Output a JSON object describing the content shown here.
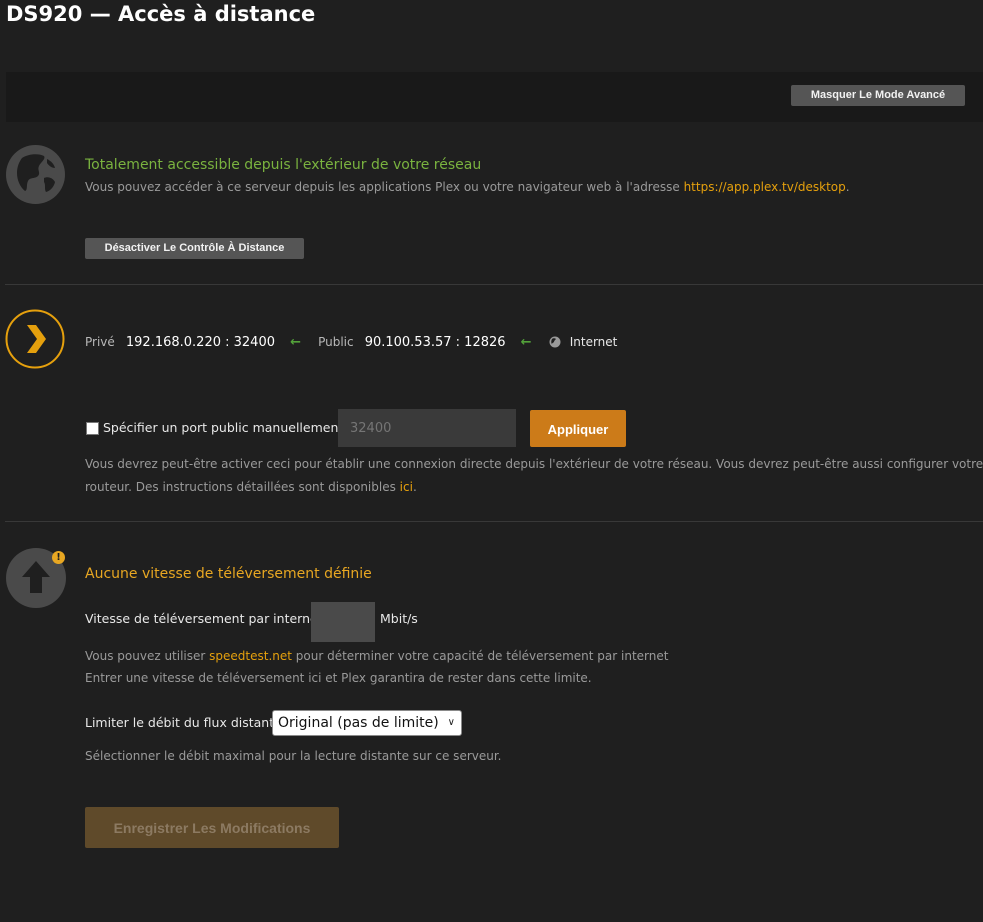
{
  "page": {
    "title": "DS920 — Accès à distance"
  },
  "toolbar": {
    "advanced_button": "Masquer Le Mode Avancé"
  },
  "status": {
    "title": "Totalement accessible depuis l'extérieur de votre réseau",
    "desc_prefix": "Vous pouvez accéder à ce serveur depuis les applications Plex ou votre navigateur web à l'adresse ",
    "desc_link": "https://app.plex.tv/desktop",
    "desc_suffix": ".",
    "disable_button": "Désactiver Le Contrôle À Distance",
    "icon": "globe-icon"
  },
  "connection": {
    "private_label": "Privé",
    "private_value": "192.168.0.220 : 32400",
    "public_label": "Public",
    "public_value": "90.100.53.57 : 12826",
    "internet_label": "Internet",
    "icon": "plex-chevron-icon"
  },
  "manual_port": {
    "checkbox_label": "Spécifier un port public manuellement",
    "checked": false,
    "placeholder": "32400",
    "apply_button": "Appliquer",
    "help_line1": "Vous devrez peut-être activer ceci pour établir une connexion directe depuis l'extérieur de votre réseau. Vous devrez peut-être aussi configurer votre",
    "help_line2_prefix": "routeur. Des instructions détaillées sont disponibles ",
    "help_link": "ici",
    "help_line2_suffix": "."
  },
  "upload": {
    "warning_title": "Aucune vitesse de téléversement définie",
    "speed_label": "Vitesse de téléversement par internet",
    "speed_value": "",
    "speed_unit": "Mbit/s",
    "help_prefix": "Vous pouvez utiliser ",
    "help_link": "speedtest.net",
    "help_suffix": " pour déterminer votre capacité de téléversement par internet",
    "help_line2": "Entrer une vitesse de téléversement ici et Plex garantira de rester dans cette limite.",
    "limit_label": "Limiter le débit du flux distant",
    "limit_selected": "Original (pas de limite)",
    "limit_help": "Sélectionner le débit maximal pour la lecture distante sur ce serveur.",
    "icon": "upload-arrow-icon",
    "badge": "!"
  },
  "actions": {
    "save_button": "Enregistrer Les Modifications"
  },
  "colors": {
    "accent": "#cc7b19",
    "success": "#7ab33f",
    "warning": "#e8a722",
    "link": "#e5a00d",
    "background": "#1f1f1f"
  }
}
